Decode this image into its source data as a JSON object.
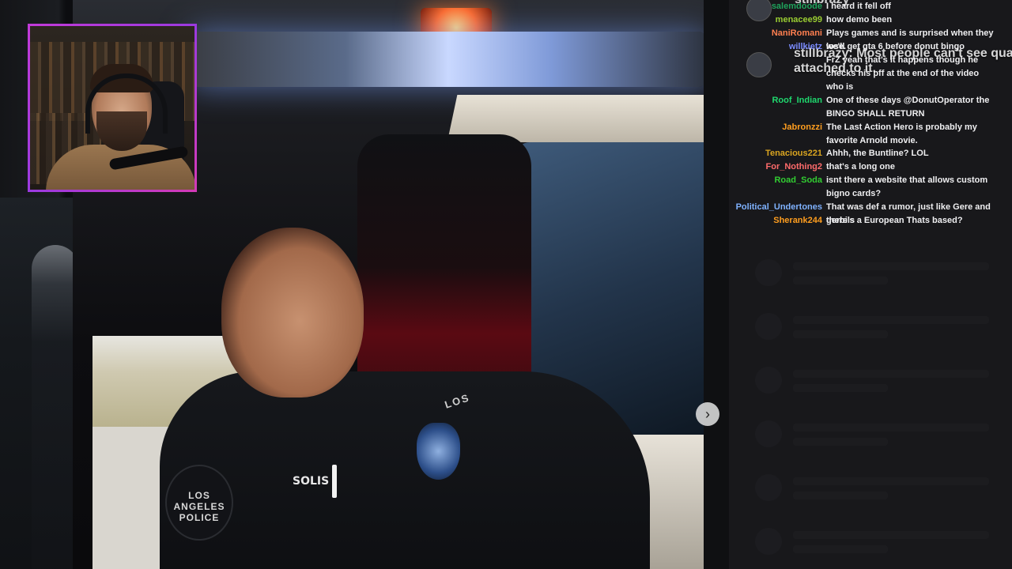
{
  "chat": {
    "overlay_top": "stillbrazy",
    "overlay_text_lines": [
      "stillbrazy: Most people can't see qua",
      "attached to it."
    ],
    "messages": [
      {
        "user": "salemdoode",
        "text": "I heard it fell off",
        "color": "#1fa35c"
      },
      {
        "user": "menacee99",
        "text": "how demo been",
        "color": "#9acd32"
      },
      {
        "user": "NaniRomani",
        "text": "Plays games and is surprised when they lose.",
        "color": "#ff7f50"
      },
      {
        "user": "willkietz",
        "text": "we'll get gta 6 before donut bingo",
        "color": "#7b8cff"
      },
      {
        "user": "",
        "text": "FrZ yeah that's it happens though he checks his pff at the end of the video",
        "color": "#4a6cff"
      },
      {
        "user": "",
        "text": "who is",
        "color": "#4a6cff"
      },
      {
        "user": "Roof_Indian",
        "text": "One of these days @DonutOperator the BINGO SHALL RETURN",
        "color": "#1fd86e"
      },
      {
        "user": "Jabronzzi",
        "text": "The Last Action Hero is probably my favorite Arnold movie.",
        "color": "#ff9e1f"
      },
      {
        "user": "Tenacious221",
        "text": "Ahhh, the Buntline? LOL",
        "color": "#daa520"
      },
      {
        "user": "For_Nothing2",
        "text": "that's a long one",
        "color": "#ff6b6b"
      },
      {
        "user": "Road_Soda",
        "text": "isnt there a website that allows custom bigno cards?",
        "color": "#32cd32"
      },
      {
        "user": "Political_Undertones",
        "text": "That was def a rumor, just like Gere and gerbils",
        "color": "#7fb2ff"
      },
      {
        "user": "Sherank244",
        "text": "there's a European Thats based?",
        "color": "#ff9e1f"
      }
    ]
  },
  "stream": {
    "patch_text": "LOS ANGELES POLICE",
    "nametag": "SOLIS",
    "shoulder_text": "LOS",
    "next_icon": "›"
  }
}
